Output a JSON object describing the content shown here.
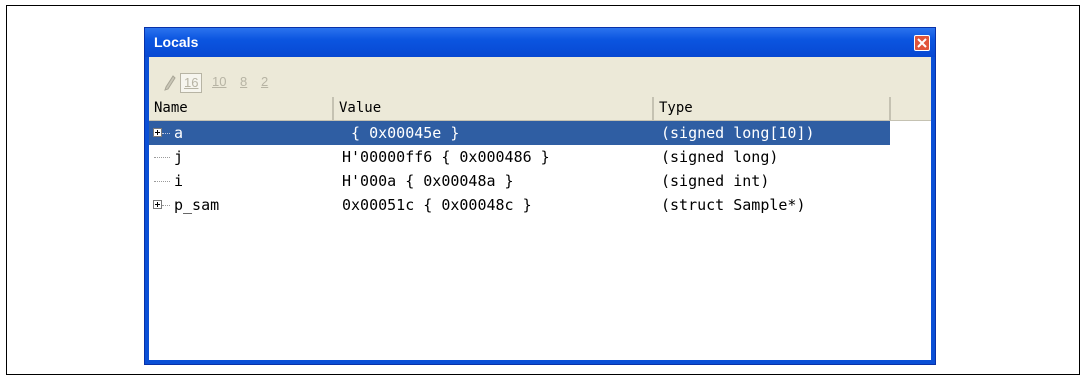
{
  "window": {
    "title": "Locals"
  },
  "toolbar": {
    "radix_16": "16",
    "radix_10": "10",
    "radix_8": "8",
    "radix_2": "2"
  },
  "columns": {
    "name": "Name",
    "value": "Value",
    "type": "Type"
  },
  "rows": [
    {
      "name": "a",
      "value": " { 0x00045e }",
      "type": "(signed long[10])",
      "expandable": true,
      "selected": true
    },
    {
      "name": "j",
      "value": "H'00000ff6 { 0x000486 }",
      "type": "(signed long)",
      "expandable": false,
      "selected": false
    },
    {
      "name": "i",
      "value": "H'000a { 0x00048a }",
      "type": "(signed int)",
      "expandable": false,
      "selected": false
    },
    {
      "name": "p_sam",
      "value": "0x00051c { 0x00048c }",
      "type": "(struct Sample*)",
      "expandable": true,
      "selected": false
    }
  ],
  "icons": {
    "edit": "pencil-icon",
    "close": "close-icon",
    "expand": "plus-expander-icon"
  },
  "colors": {
    "titlebar": "#0b55e0",
    "selection": "#2f5ea3",
    "toolbar_bg": "#ece9d8"
  }
}
